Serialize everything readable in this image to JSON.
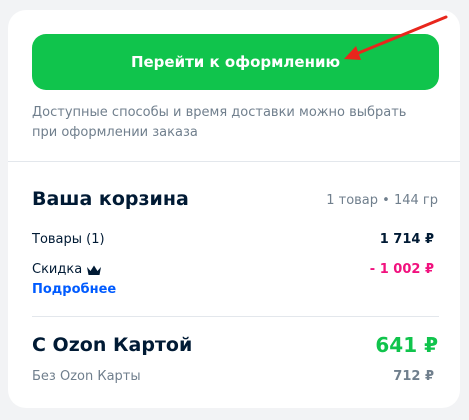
{
  "checkout": {
    "button_label": "Перейти к оформлению",
    "hint": "Доступные способы и время доставки можно выбрать при оформлении заказа"
  },
  "cart": {
    "title": "Ваша корзина",
    "meta": "1 товар • 144 гр",
    "goods_label": "Товары (1)",
    "goods_value": "1 714 ₽",
    "discount_label": "Скидка",
    "discount_value": "- 1 002 ₽",
    "details_link": "Подробнее",
    "ozon_card_label": "С Ozon Картой",
    "ozon_card_value": "641 ₽",
    "no_card_label": "Без Ozon Карты",
    "no_card_value": "712 ₽"
  },
  "colors": {
    "accent_green": "#10c44c",
    "discount_pink": "#f1117e",
    "link_blue": "#005bff",
    "annotation_red": "#e8261c"
  },
  "icons": {
    "discount": "crown-icon",
    "annotation": "red-arrow"
  }
}
